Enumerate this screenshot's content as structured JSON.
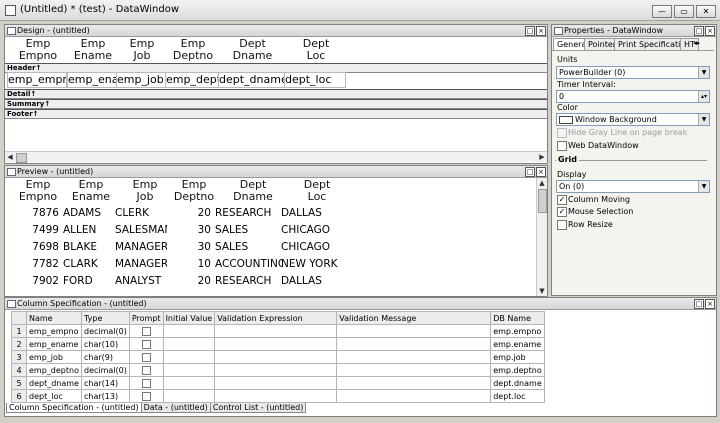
{
  "window": {
    "title": "(Untitled) * (test) - DataWindow",
    "minimize": "—",
    "restore": "▭",
    "close": "✕"
  },
  "design": {
    "title": "Design - (untitled)",
    "headers": [
      "Emp\nEmpno",
      "Emp\nEname",
      "Emp\nJob",
      "Emp\nDeptno",
      "Dept\nDname",
      "Dept\nLoc"
    ],
    "detail": [
      "emp_empno",
      "emp_ename",
      "emp_job",
      "emp_deptno",
      "dept_dname",
      "dept_loc"
    ],
    "bands": {
      "header": "Header↑",
      "detail": "Detail↑",
      "summary": "Summary↑",
      "footer": "Footer↑"
    }
  },
  "preview": {
    "title": "Preview - (untitled)",
    "headers": [
      "Emp\nEmpno",
      "Emp\nEname",
      "Emp\nJob",
      "Emp\nDeptno",
      "Dept\nDname",
      "Dept\nLoc"
    ],
    "rows": [
      [
        "7876",
        "ADAMS",
        "CLERK",
        "20",
        "RESEARCH",
        "DALLAS"
      ],
      [
        "7499",
        "ALLEN",
        "SALESMAN",
        "30",
        "SALES",
        "CHICAGO"
      ],
      [
        "7698",
        "BLAKE",
        "MANAGER",
        "30",
        "SALES",
        "CHICAGO"
      ],
      [
        "7782",
        "CLARK",
        "MANAGER",
        "10",
        "ACCOUNTING",
        "NEW YORK"
      ],
      [
        "7902",
        "FORD",
        "ANALYST",
        "20",
        "RESEARCH",
        "DALLAS"
      ]
    ]
  },
  "spec": {
    "title": "Column Specification - (untitled)",
    "columns": [
      "Name",
      "Type",
      "Prompt",
      "Initial Value",
      "Validation Expression",
      "Validation Message",
      "DB Name"
    ],
    "rows": [
      [
        "1",
        "emp_empno",
        "decimal(0)",
        "",
        "",
        "",
        "",
        "emp.empno"
      ],
      [
        "2",
        "emp_ename",
        "char(10)",
        "",
        "",
        "",
        "",
        "emp.ename"
      ],
      [
        "3",
        "emp_job",
        "char(9)",
        "",
        "",
        "",
        "",
        "emp.job"
      ],
      [
        "4",
        "emp_deptno",
        "decimal(0)",
        "",
        "",
        "",
        "",
        "emp.deptno"
      ],
      [
        "5",
        "dept_dname",
        "char(14)",
        "",
        "",
        "",
        "",
        "dept.dname"
      ],
      [
        "6",
        "dept_loc",
        "char(13)",
        "",
        "",
        "",
        "",
        "dept.loc"
      ]
    ]
  },
  "bottom_tabs": [
    "Column Specification - (untitled)",
    "Data - (untitled)",
    "Control List - (untitled)"
  ],
  "properties": {
    "title": "Properties - DataWindow",
    "tabs": [
      "General",
      "Pointer",
      "Print Specifications",
      "HT"
    ],
    "units_label": "Units",
    "units_value": "PowerBuilder (0)",
    "timer_label": "Timer Interval:",
    "timer_value": "0",
    "color_label": "Color",
    "color_value": "Window Background",
    "hide_gray_line": "Hide Gray Line on page break",
    "web_datawindow": "Web DataWindow",
    "grid_section": "Grid",
    "display_label": "Display",
    "display_value": "On (0)",
    "column_moving": "Column Moving",
    "mouse_selection": "Mouse Selection",
    "row_resize": "Row Resize",
    "check_mark": "✓"
  }
}
